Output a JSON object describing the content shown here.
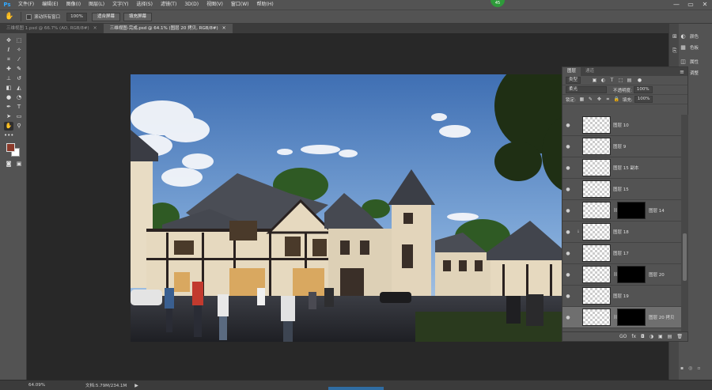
{
  "app": {
    "logo": "Ps"
  },
  "menu": [
    "文件(F)",
    "编辑(E)",
    "图像(I)",
    "图层(L)",
    "文字(Y)",
    "选择(S)",
    "滤镜(T)",
    "3D(D)",
    "视图(V)",
    "窗口(W)",
    "帮助(H)"
  ],
  "window_controls": {
    "minimize": "—",
    "maximize": "▭",
    "close": "✕"
  },
  "badge": {
    "value": "45"
  },
  "options": {
    "scroll_all_label": "滚动所有窗口",
    "zoom_value": "100%",
    "fit_screen": "适合屏幕",
    "fill_screen": "填充屏幕"
  },
  "tabs": [
    {
      "label": "三维视图 1.psd @ 66.7% (AO, RGB/8#)",
      "close": "×"
    },
    {
      "label": "三维视图-完成.psd @ 64.1% (图层 20 拷贝, RGB/8#)",
      "close": "×"
    }
  ],
  "dock": {
    "items": [
      {
        "icon": "palette-icon",
        "label": "颜色"
      },
      {
        "icon": "swatches-icon",
        "label": "色板"
      },
      {
        "icon": "properties-icon",
        "label": "属性"
      },
      {
        "icon": "adjustments-icon",
        "label": "调整"
      }
    ]
  },
  "layers_panel": {
    "tabs": [
      "图层",
      "通道"
    ],
    "filter_kind": "类型",
    "blend_mode": "柔光",
    "opacity_label": "不透明度:",
    "opacity_value": "100%",
    "lock_label": "锁定:",
    "fill_label": "填充:",
    "fill_value": "100%",
    "layers": [
      {
        "name": "图层 10",
        "mask": false,
        "indent": false,
        "selected": false
      },
      {
        "name": "图层 9",
        "mask": false,
        "indent": false,
        "selected": false
      },
      {
        "name": "图层 15 副本",
        "mask": false,
        "indent": false,
        "selected": false
      },
      {
        "name": "图层 15",
        "mask": false,
        "indent": false,
        "selected": false
      },
      {
        "name": "图层 14",
        "mask": true,
        "indent": false,
        "selected": false
      },
      {
        "name": "图层 18",
        "mask": false,
        "indent": true,
        "selected": false
      },
      {
        "name": "图层 17",
        "mask": false,
        "indent": false,
        "selected": false
      },
      {
        "name": "图层 20",
        "mask": true,
        "indent": false,
        "selected": false
      },
      {
        "name": "图层 19",
        "mask": false,
        "indent": false,
        "selected": false
      },
      {
        "name": "图层 20 拷贝",
        "mask": true,
        "indent": false,
        "selected": true
      }
    ],
    "footer": [
      "GO",
      "fx",
      "◘",
      "◑",
      "▣",
      "▤",
      "🗑"
    ]
  },
  "status": {
    "zoom": "64.09%",
    "doc": "文档:5.79M/234.1M",
    "arrow": "▶"
  }
}
